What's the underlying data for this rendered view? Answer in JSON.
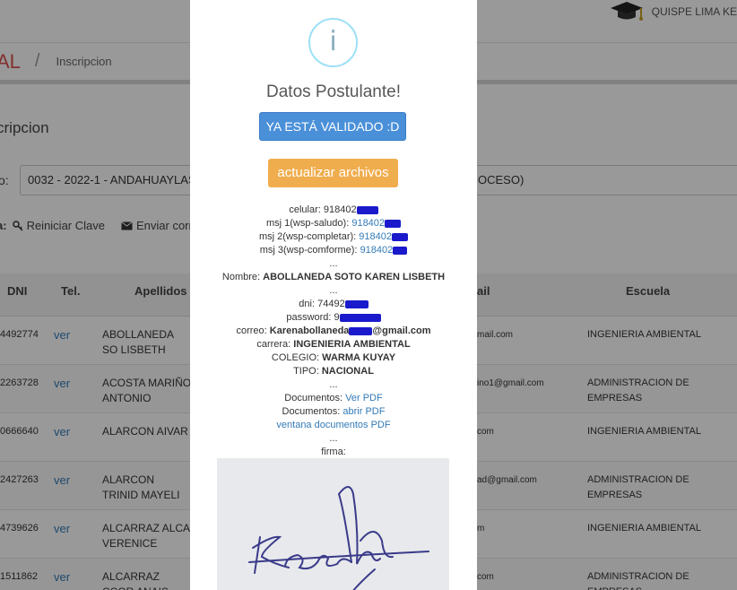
{
  "header": {
    "user_name": "QUISPE LIMA KE",
    "breadcrumb_main": "AL",
    "breadcrumb_sep": "/",
    "breadcrumb_current": "Inscripcion"
  },
  "page": {
    "section_title": "cripcion",
    "process_label": "o:",
    "process_value": "0032 - 2022-1 - ANDAHUAYLAS",
    "process_tail": "OCESO)",
    "actions_label": "a:",
    "reset_key": "Reiniciar Clave",
    "send_mail": "Enviar corr"
  },
  "table": {
    "headers": [
      "DNI",
      "Tel.",
      "Apellidos y",
      "ail",
      "Escuela"
    ],
    "rows": [
      {
        "dni": "4492774",
        "tel": "ver",
        "name": "ABOLLANEDA SO LISBETH",
        "mail": "mail.com",
        "school": "INGENIERIA AMBIENTAL"
      },
      {
        "dni": "2263728",
        "tel": "ver",
        "name": "ACOSTA MARIÑO ANTONIO",
        "mail": "ino1@gmail.com",
        "school": "ADMINISTRACION DE EMPRESAS"
      },
      {
        "dni": "0666640",
        "tel": "ver",
        "name": "ALARCON AIVAR",
        "mail": "com",
        "school": "INGENIERIA AMBIENTAL"
      },
      {
        "dni": "2427263",
        "tel": "ver",
        "name": "ALARCON TRINID MAYELI",
        "mail": "ad@gmail.com",
        "school": "ADMINISTRACION DE EMPRESAS"
      },
      {
        "dni": "4739626",
        "tel": "ver",
        "name": "ALCARRAZ ALCA VERENICE",
        "mail": "m",
        "school": "INGENIERIA AMBIENTAL"
      },
      {
        "dni": "1511862",
        "tel": "ver",
        "name": "ALCARRAZ CCOR ANAIS",
        "mail": "com",
        "school": "ADMINISTRACION DE EMPRESAS"
      }
    ]
  },
  "modal": {
    "icon": "i",
    "title": "Datos Postulante!",
    "validated_button": "YA ESTÁ VALIDADO :D",
    "update_button": "actualizar archivos",
    "celular_label": "celular:",
    "celular_value": "918402",
    "msj1_label": "msj 1(wsp-saludo):",
    "msj1_value": "918402",
    "msj2_label": "msj 2(wsp-completar):",
    "msj2_value": "918402",
    "msj3_label": "msj 3(wsp-comforme):",
    "msj3_value": "918402",
    "dots": "...",
    "nombre_label": "Nombre:",
    "nombre_value": "ABOLLANEDA SOTO KAREN LISBETH",
    "dni_label": "dni:",
    "dni_value": "74492",
    "password_label": "password:",
    "password_value": "9",
    "correo_label": "correo:",
    "correo_value_start": "Karenabollaneda",
    "correo_value_end": "@gmail.com",
    "carrera_label": "carrera:",
    "carrera_value": "INGENIERIA AMBIENTAL",
    "colegio_label": "COLEGIO:",
    "colegio_value": "WARMA KUYAY",
    "tipo_label": "TIPO:",
    "tipo_value": "NACIONAL",
    "docs1_label": "Documentos:",
    "docs1_link": "Ver PDF",
    "docs2_label": "Documentos:",
    "docs2_link": "abrir PDF",
    "docs_window_link": "ventana documentos PDF",
    "firma_label": "firma:"
  },
  "colors": {
    "accent_blue": "#4a90d9",
    "accent_orange": "#f0ad4e",
    "breadcrumb_red": "#d9534f",
    "redaction_blue": "#1a1acc"
  }
}
